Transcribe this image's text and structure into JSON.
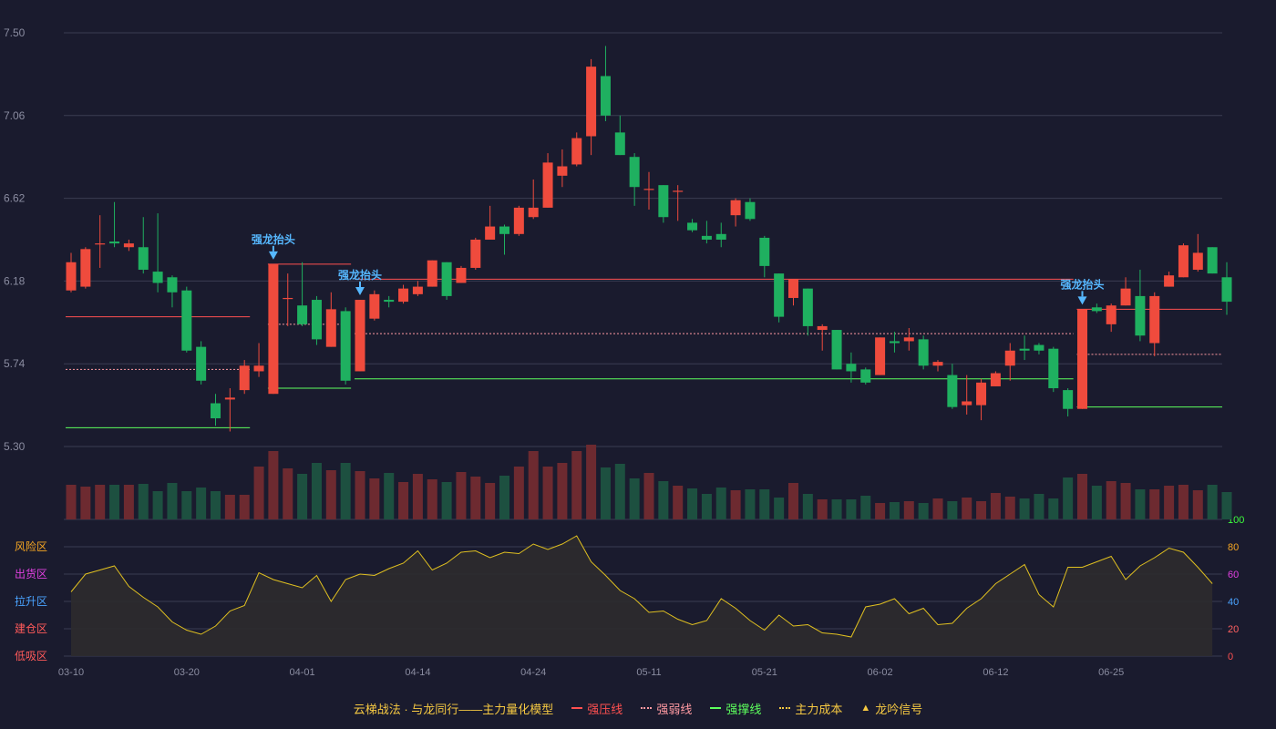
{
  "chart_data": {
    "type": "candlestick",
    "title": "",
    "x_ticks": [
      "03-10",
      "03-20",
      "04-01",
      "04-14",
      "04-24",
      "05-11",
      "05-21",
      "06-02",
      "06-12",
      "06-25"
    ],
    "y_ticks": [
      "7.50",
      "7.06",
      "6.62",
      "6.18",
      "5.74",
      "5.30"
    ],
    "ylim": [
      5.3,
      7.5
    ],
    "sub_y_ticks_right": [
      "100",
      "80",
      "60",
      "40",
      "20",
      "0"
    ],
    "sub_y_labels_left": [
      "风险区",
      "出货区",
      "拉升区",
      "建仓区",
      "低吸区"
    ],
    "sub_ylim": [
      0,
      100
    ],
    "signal_label": "强龙抬头",
    "candles": [
      [
        6.13,
        6.28,
        6.12,
        6.33
      ],
      [
        6.15,
        6.35,
        6.14,
        6.36
      ],
      [
        6.38,
        6.38,
        6.25,
        6.53
      ],
      [
        6.39,
        6.38,
        6.36,
        6.6
      ],
      [
        6.36,
        6.38,
        6.34,
        6.4
      ],
      [
        6.36,
        6.24,
        6.22,
        6.52
      ],
      [
        6.23,
        6.17,
        6.12,
        6.54
      ],
      [
        6.2,
        6.12,
        6.04,
        6.21
      ],
      [
        6.13,
        5.81,
        5.8,
        6.15
      ],
      [
        5.83,
        5.65,
        5.63,
        5.86
      ],
      [
        5.53,
        5.45,
        5.41,
        5.58
      ],
      [
        5.55,
        5.56,
        5.38,
        5.61
      ],
      [
        5.6,
        5.73,
        5.58,
        5.76
      ],
      [
        5.7,
        5.73,
        5.67,
        5.85
      ],
      [
        5.58,
        6.27,
        5.58,
        6.27
      ],
      [
        6.09,
        6.09,
        5.94,
        6.22
      ],
      [
        6.05,
        5.95,
        5.94,
        6.28
      ],
      [
        6.08,
        5.87,
        5.84,
        6.1
      ],
      [
        5.83,
        6.03,
        5.83,
        6.12
      ],
      [
        6.02,
        5.65,
        5.63,
        6.04
      ],
      [
        5.7,
        6.08,
        5.7,
        6.08
      ],
      [
        5.98,
        6.11,
        5.97,
        6.13
      ],
      [
        6.08,
        6.07,
        6.04,
        6.1
      ],
      [
        6.07,
        6.14,
        6.06,
        6.16
      ],
      [
        6.11,
        6.15,
        6.1,
        6.18
      ],
      [
        6.15,
        6.29,
        6.15,
        6.29
      ],
      [
        6.28,
        6.1,
        6.08,
        6.28
      ],
      [
        6.17,
        6.25,
        6.17,
        6.26
      ],
      [
        6.25,
        6.4,
        6.24,
        6.41
      ],
      [
        6.4,
        6.47,
        6.4,
        6.58
      ],
      [
        6.47,
        6.43,
        6.32,
        6.48
      ],
      [
        6.43,
        6.57,
        6.42,
        6.58
      ],
      [
        6.52,
        6.57,
        6.51,
        6.72
      ],
      [
        6.57,
        6.81,
        6.57,
        6.86
      ],
      [
        6.74,
        6.79,
        6.68,
        6.88
      ],
      [
        6.8,
        6.94,
        6.79,
        6.97
      ],
      [
        6.95,
        7.32,
        6.85,
        7.36
      ],
      [
        7.27,
        7.06,
        7.03,
        7.43
      ],
      [
        6.97,
        6.85,
        6.85,
        7.06
      ],
      [
        6.84,
        6.68,
        6.58,
        6.86
      ],
      [
        6.67,
        6.67,
        6.56,
        6.76
      ],
      [
        6.69,
        6.52,
        6.49,
        6.69
      ],
      [
        6.66,
        6.66,
        6.5,
        6.69
      ],
      [
        6.49,
        6.45,
        6.44,
        6.51
      ],
      [
        6.42,
        6.4,
        6.38,
        6.5
      ],
      [
        6.43,
        6.4,
        6.36,
        6.49
      ],
      [
        6.53,
        6.61,
        6.47,
        6.62
      ],
      [
        6.6,
        6.51,
        6.5,
        6.62
      ],
      [
        6.41,
        6.26,
        6.2,
        6.42
      ],
      [
        6.22,
        5.99,
        5.96,
        6.22
      ],
      [
        6.09,
        6.19,
        6.05,
        6.19
      ],
      [
        6.14,
        5.94,
        5.89,
        6.14
      ],
      [
        5.92,
        5.94,
        5.81,
        5.95
      ],
      [
        5.92,
        5.71,
        5.71,
        5.92
      ],
      [
        5.74,
        5.7,
        5.64,
        5.8
      ],
      [
        5.71,
        5.64,
        5.63,
        5.72
      ],
      [
        5.68,
        5.88,
        5.68,
        5.88
      ],
      [
        5.86,
        5.85,
        5.8,
        5.91
      ],
      [
        5.86,
        5.88,
        5.81,
        5.93
      ],
      [
        5.87,
        5.73,
        5.71,
        5.89
      ],
      [
        5.73,
        5.75,
        5.7,
        5.76
      ],
      [
        5.68,
        5.51,
        5.5,
        5.74
      ],
      [
        5.52,
        5.54,
        5.47,
        5.68
      ],
      [
        5.52,
        5.64,
        5.44,
        5.66
      ],
      [
        5.62,
        5.69,
        5.62,
        5.7
      ],
      [
        5.73,
        5.81,
        5.65,
        5.85
      ],
      [
        5.82,
        5.81,
        5.76,
        5.89
      ],
      [
        5.84,
        5.81,
        5.79,
        5.85
      ],
      [
        5.82,
        5.61,
        5.59,
        5.83
      ],
      [
        5.6,
        5.5,
        5.46,
        5.61
      ],
      [
        5.5,
        6.03,
        5.5,
        6.03
      ],
      [
        6.04,
        6.02,
        6.01,
        6.06
      ],
      [
        5.95,
        6.05,
        5.91,
        6.06
      ],
      [
        6.05,
        6.14,
        6.05,
        6.2
      ],
      [
        6.1,
        5.89,
        5.86,
        6.24
      ],
      [
        5.85,
        6.1,
        5.78,
        6.12
      ],
      [
        6.15,
        6.21,
        6.15,
        6.23
      ],
      [
        6.2,
        6.37,
        6.2,
        6.38
      ],
      [
        6.24,
        6.33,
        6.23,
        6.43
      ],
      [
        6.36,
        6.22,
        6.22,
        6.36
      ],
      [
        6.2,
        6.07,
        6.0,
        6.28
      ]
    ],
    "volume": [
      38,
      36,
      38,
      38,
      38,
      39,
      31,
      40,
      31,
      35,
      31,
      27,
      27,
      58,
      75,
      56,
      50,
      62,
      54,
      62,
      53,
      45,
      51,
      41,
      50,
      44,
      41,
      52,
      47,
      40,
      48,
      58,
      75,
      58,
      62,
      75,
      82,
      57,
      61,
      45,
      51,
      42,
      37,
      34,
      28,
      35,
      32,
      33,
      33,
      24,
      40,
      28,
      22,
      22,
      22,
      26,
      18,
      19,
      20,
      18,
      23,
      20,
      24,
      20,
      29,
      25,
      23,
      28,
      23,
      46,
      50,
      37,
      42,
      40,
      33,
      33,
      37,
      38,
      32,
      38,
      30
    ],
    "signals": [
      14,
      20,
      70
    ],
    "levels": [
      {
        "type": "strong_resistance",
        "start": 0,
        "end": 12,
        "value": 5.99
      },
      {
        "type": "weak_line",
        "start": 0,
        "end": 12,
        "value": 5.71
      },
      {
        "type": "support_line",
        "start": 0,
        "end": 12,
        "value": 5.4
      },
      {
        "type": "strong_resistance",
        "start": 14,
        "end": 19,
        "value": 6.27
      },
      {
        "type": "weak_line",
        "start": 14,
        "end": 19,
        "value": 5.95
      },
      {
        "type": "support_line",
        "start": 14,
        "end": 19,
        "value": 5.61
      },
      {
        "type": "strong_resistance",
        "start": 20,
        "end": 69,
        "value": 6.19
      },
      {
        "type": "weak_line",
        "start": 20,
        "end": 69,
        "value": 5.9
      },
      {
        "type": "support_line",
        "start": 20,
        "end": 69,
        "value": 5.66
      },
      {
        "type": "strong_resistance",
        "start": 70,
        "end": 80,
        "value": 6.03
      },
      {
        "type": "weak_line",
        "start": 70,
        "end": 80,
        "value": 5.79
      },
      {
        "type": "support_line",
        "start": 70,
        "end": 80,
        "value": 5.51
      }
    ],
    "oscillator": [
      47,
      60,
      63,
      66,
      51,
      43,
      36,
      25,
      19,
      16,
      22,
      33,
      37,
      61,
      56,
      53,
      50,
      59,
      40,
      56,
      60,
      59,
      64,
      68,
      77,
      63,
      68,
      76,
      77,
      72,
      76,
      75,
      82,
      78,
      82,
      88,
      69,
      59,
      48,
      42,
      32,
      33,
      27,
      23,
      26,
      42,
      35,
      26,
      19,
      30,
      22,
      23,
      17,
      16,
      14,
      36,
      38,
      42,
      31,
      35,
      23,
      24,
      35,
      42,
      53,
      60,
      67,
      45,
      36,
      65,
      65,
      69,
      73,
      56,
      66,
      72,
      79,
      76,
      65,
      53
    ]
  },
  "legend": {
    "model_title": "云梯战法 · 与龙同行——主力量化模型",
    "items": [
      {
        "label": "强压线",
        "color": "#ff5050",
        "style": "solid"
      },
      {
        "label": "强弱线",
        "color": "#ff9aa2",
        "style": "dotted"
      },
      {
        "label": "强撑线",
        "color": "#5dff5d",
        "style": "solid"
      },
      {
        "label": "主力成本",
        "color": "#f5c842",
        "style": "dotted"
      },
      {
        "label": "龙吟信号",
        "color": "#f5c842",
        "style": "triangle",
        "symbol": "▲"
      }
    ]
  },
  "colors": {
    "up": "#ef4b3d",
    "down": "#1fb060",
    "up_volume": "#6d2a30",
    "down_volume": "#1d5040",
    "grid": "#3a3c52",
    "axis_text": "#8a8ca0",
    "signal": "#56b8ff",
    "oscillator_line": "#e0c020",
    "oscillator_fill": "#2e2b2d",
    "zone_colors": [
      "#f5a623",
      "#e040e0",
      "#4aa3ff",
      "#ff5a5a",
      "#ff5a5a"
    ],
    "right_tick_colors": [
      "#3dff3d",
      "#f5a623",
      "#e040e0",
      "#4aa3ff",
      "#ff6060",
      "#ff5050"
    ]
  }
}
